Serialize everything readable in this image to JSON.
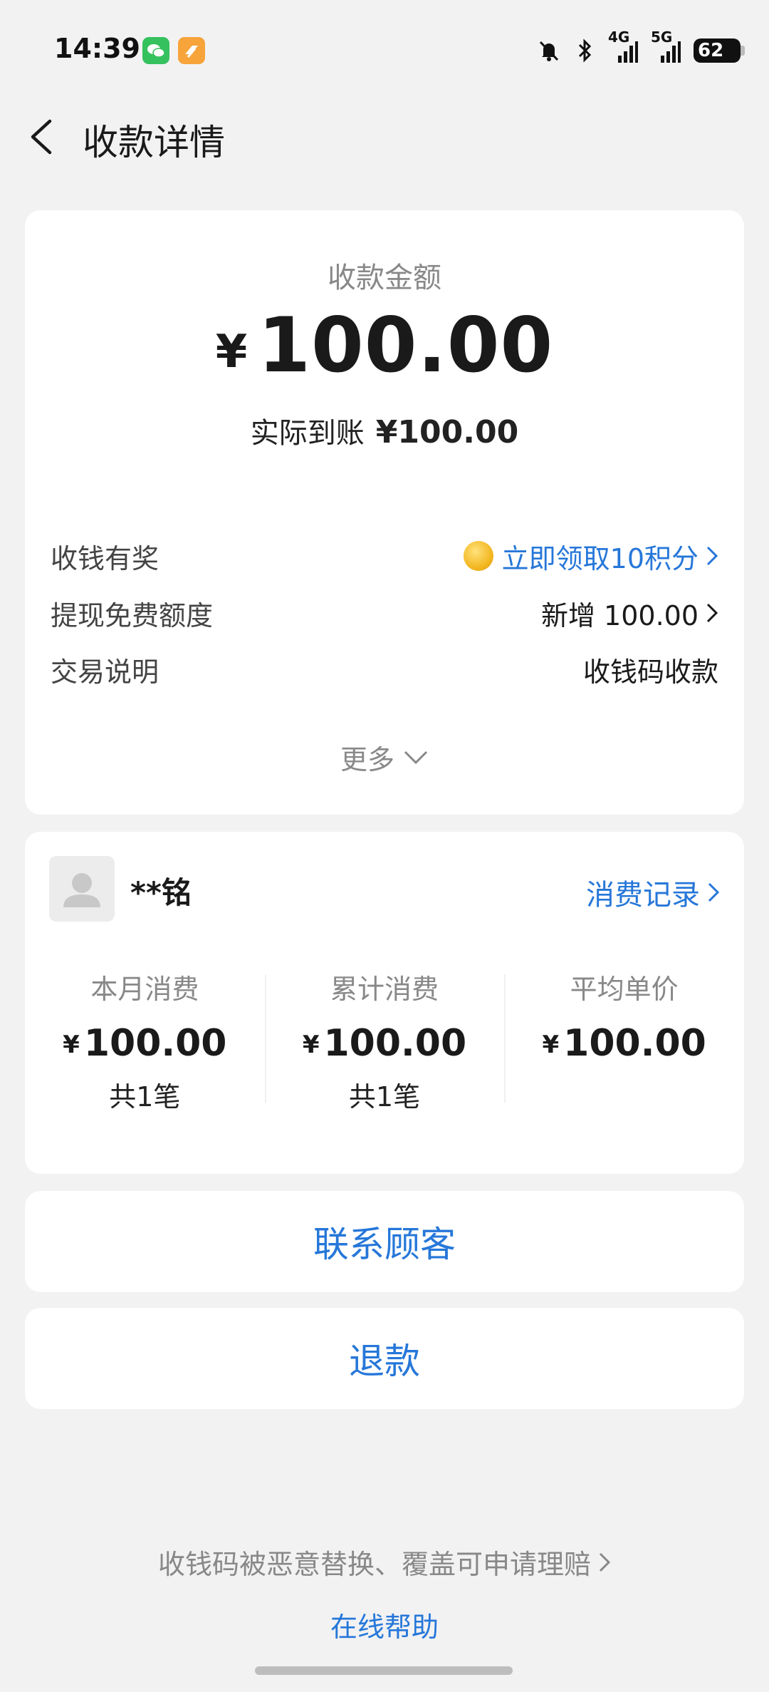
{
  "status_bar": {
    "time": "14:39",
    "network_1": "4G",
    "network_2": "5G",
    "battery": "62"
  },
  "header": {
    "title": "收款详情"
  },
  "summary": {
    "amount_label": "收款金额",
    "currency": "¥",
    "amount": "100.00",
    "received_label": "实际到账",
    "received_value": "¥100.00"
  },
  "details": [
    {
      "label": "收钱有奖",
      "value": "立即领取10积分"
    },
    {
      "label": "提现免费额度",
      "value": "新增 100.00"
    },
    {
      "label": "交易说明",
      "value": "收钱码收款"
    }
  ],
  "more_label": "更多",
  "customer": {
    "name": "**铭",
    "records_label": "消费记录",
    "stats": [
      {
        "title": "本月消费",
        "currency": "¥",
        "value": "100.00",
        "count": "共1笔"
      },
      {
        "title": "累计消费",
        "currency": "¥",
        "value": "100.00",
        "count": "共1笔"
      },
      {
        "title": "平均单价",
        "currency": "¥",
        "value": "100.00",
        "count": ""
      }
    ]
  },
  "actions": {
    "contact": "联系顾客",
    "refund": "退款"
  },
  "footer": {
    "claim_text": "收钱码被恶意替换、覆盖可申请理赔",
    "help_text": "在线帮助"
  },
  "colors": {
    "accent": "#2677d9",
    "background": "#f2f2f3",
    "card": "#ffffff"
  }
}
